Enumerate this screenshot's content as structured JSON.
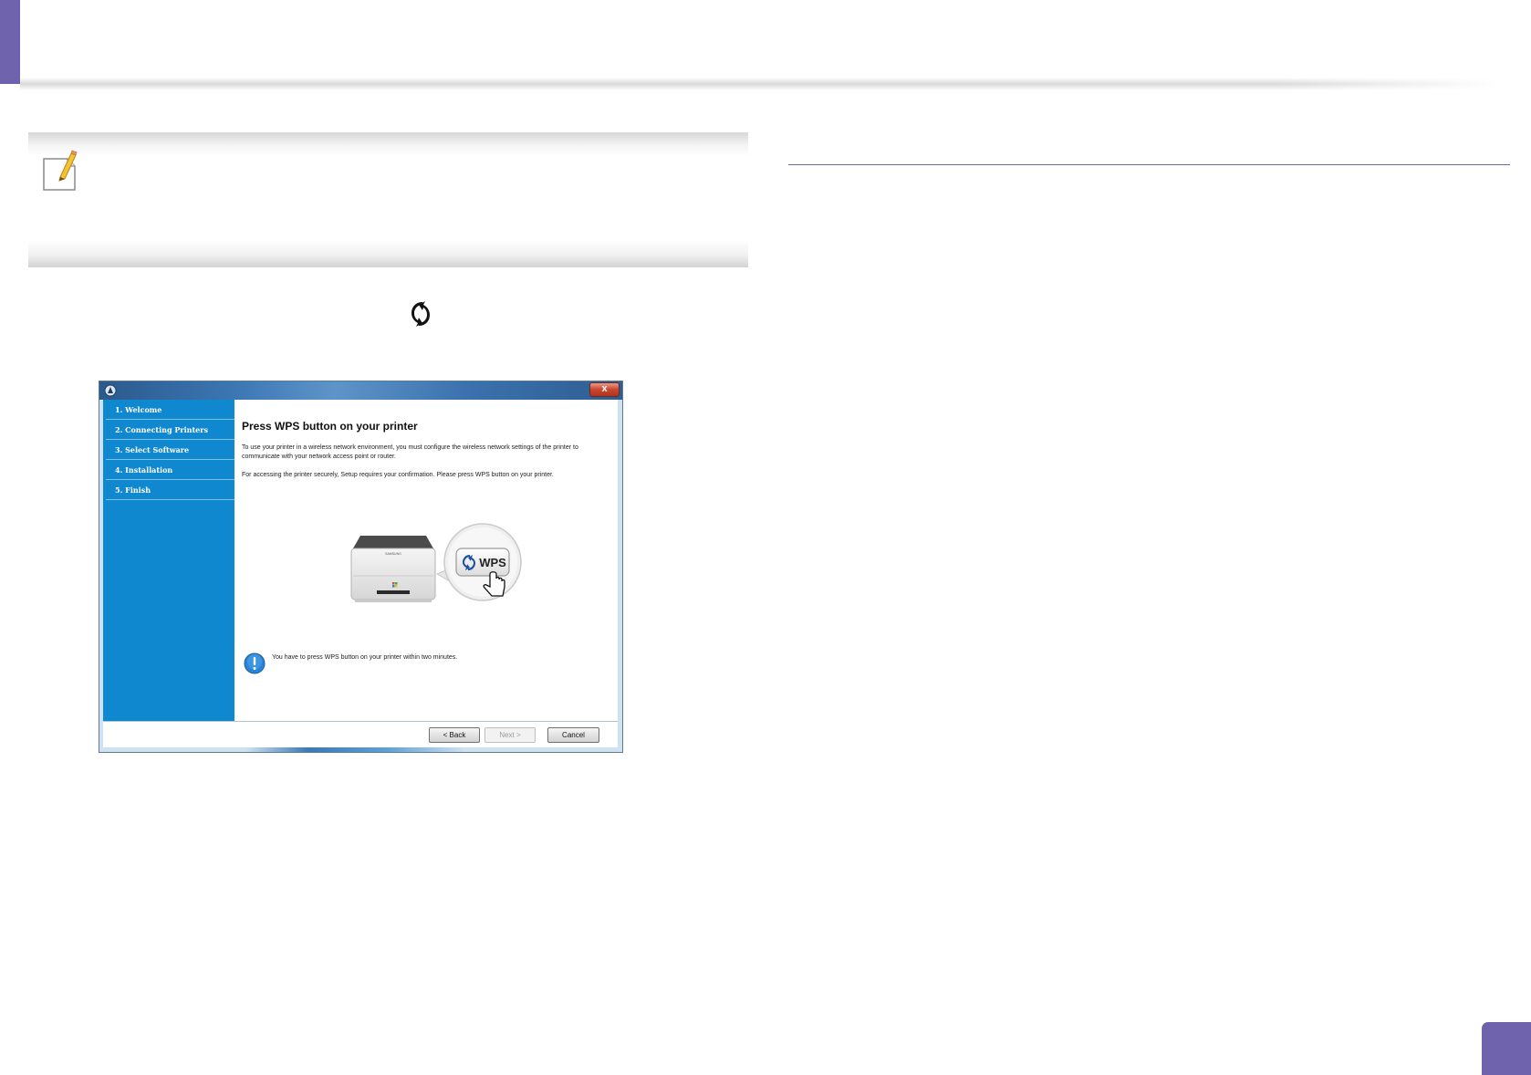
{
  "dialog": {
    "close_label": "x",
    "steps": [
      "1. Welcome",
      "2. Connecting Printers",
      "3. Select Software",
      "4. Installation",
      "5. Finish"
    ],
    "heading": "Press WPS button on your printer",
    "paragraph1": "To use your printer in a wireless network environment, you must configure the wireless network settings of the printer to communicate with your network access point or router.",
    "paragraph2": "For accessing the printer securely, Setup requires your confirmation. Please press WPS button on your printer.",
    "illustration": {
      "printer_brand": "SAMSUNG",
      "button_label": "WPS"
    },
    "warning": "You have to press WPS button on your printer within two minutes.",
    "buttons": {
      "back": "< Back",
      "next": "Next >",
      "cancel": "Cancel"
    }
  },
  "icons": {
    "note": "pencil-note-icon",
    "wps": "wps-icon",
    "info": "info-icon"
  },
  "colors": {
    "accent": "#6f63ad",
    "sidebar": "#0f88cf",
    "titlebar": "#3b75b2"
  }
}
